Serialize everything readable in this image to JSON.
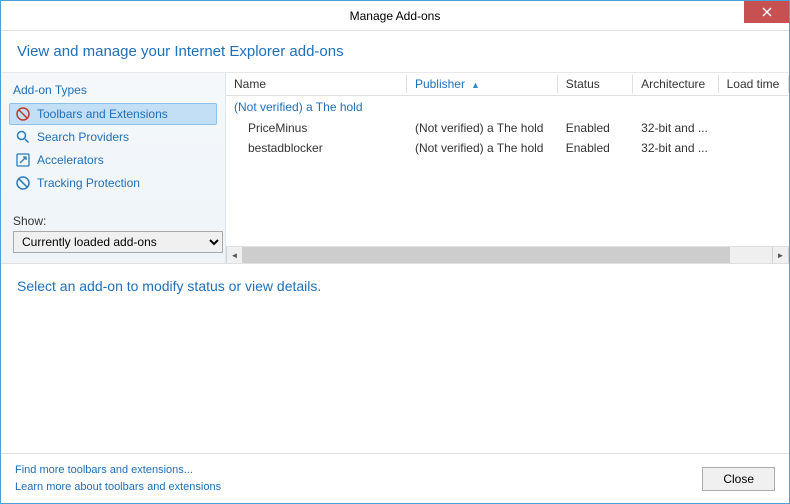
{
  "window": {
    "title": "Manage Add-ons"
  },
  "header": {
    "title": "View and manage your Internet Explorer add-ons"
  },
  "sidebar": {
    "heading": "Add-on Types",
    "items": [
      {
        "label": "Toolbars and Extensions"
      },
      {
        "label": "Search Providers"
      },
      {
        "label": "Accelerators"
      },
      {
        "label": "Tracking Protection"
      }
    ],
    "show_label": "Show:",
    "show_value": "Currently loaded add-ons"
  },
  "table": {
    "columns": {
      "name": "Name",
      "publisher": "Publisher",
      "status": "Status",
      "architecture": "Architecture",
      "loadtime": "Load time"
    },
    "group": "(Not verified) a The hold",
    "rows": [
      {
        "name": "PriceMinus",
        "publisher": "(Not verified) a The hold",
        "status": "Enabled",
        "architecture": "32-bit and ...",
        "loadtime": ""
      },
      {
        "name": "bestadblocker",
        "publisher": "(Not verified) a The hold",
        "status": "Enabled",
        "architecture": "32-bit and ...",
        "loadtime": ""
      }
    ]
  },
  "details": {
    "message": "Select an add-on to modify status or view details."
  },
  "footer": {
    "link1": "Find more toolbars and extensions...",
    "link2": "Learn more about toolbars and extensions",
    "close": "Close"
  }
}
